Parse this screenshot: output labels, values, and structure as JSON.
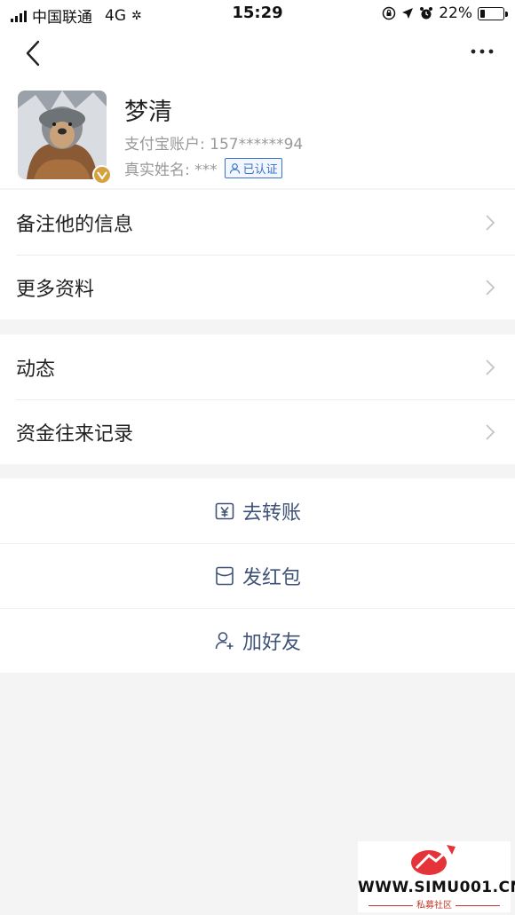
{
  "status_bar": {
    "carrier": "中国联通",
    "network": "4G",
    "time": "15:29",
    "battery": "22%",
    "battery_level": 0.22
  },
  "profile": {
    "name": "梦清",
    "account_label": "支付宝账户:",
    "account_value": "157******94",
    "realname_label": "真实姓名:",
    "realname_value": "***",
    "verified_label": "已认证"
  },
  "menu_group1": [
    {
      "label": "备注他的信息"
    },
    {
      "label": "更多资料"
    }
  ],
  "menu_group2": [
    {
      "label": "动态"
    },
    {
      "label": "资金往来记录"
    }
  ],
  "actions": [
    {
      "label": "去转账",
      "icon": "yuan-transfer-icon"
    },
    {
      "label": "发红包",
      "icon": "red-envelope-icon"
    },
    {
      "label": "加好友",
      "icon": "add-friend-icon"
    }
  ],
  "watermark": {
    "text": "WWW.SIMU001.CN",
    "subtext": "私募社区"
  },
  "colors": {
    "accent_blue": "#3a73c9",
    "action_text": "#3f5277",
    "background": "#f4f4f4"
  }
}
